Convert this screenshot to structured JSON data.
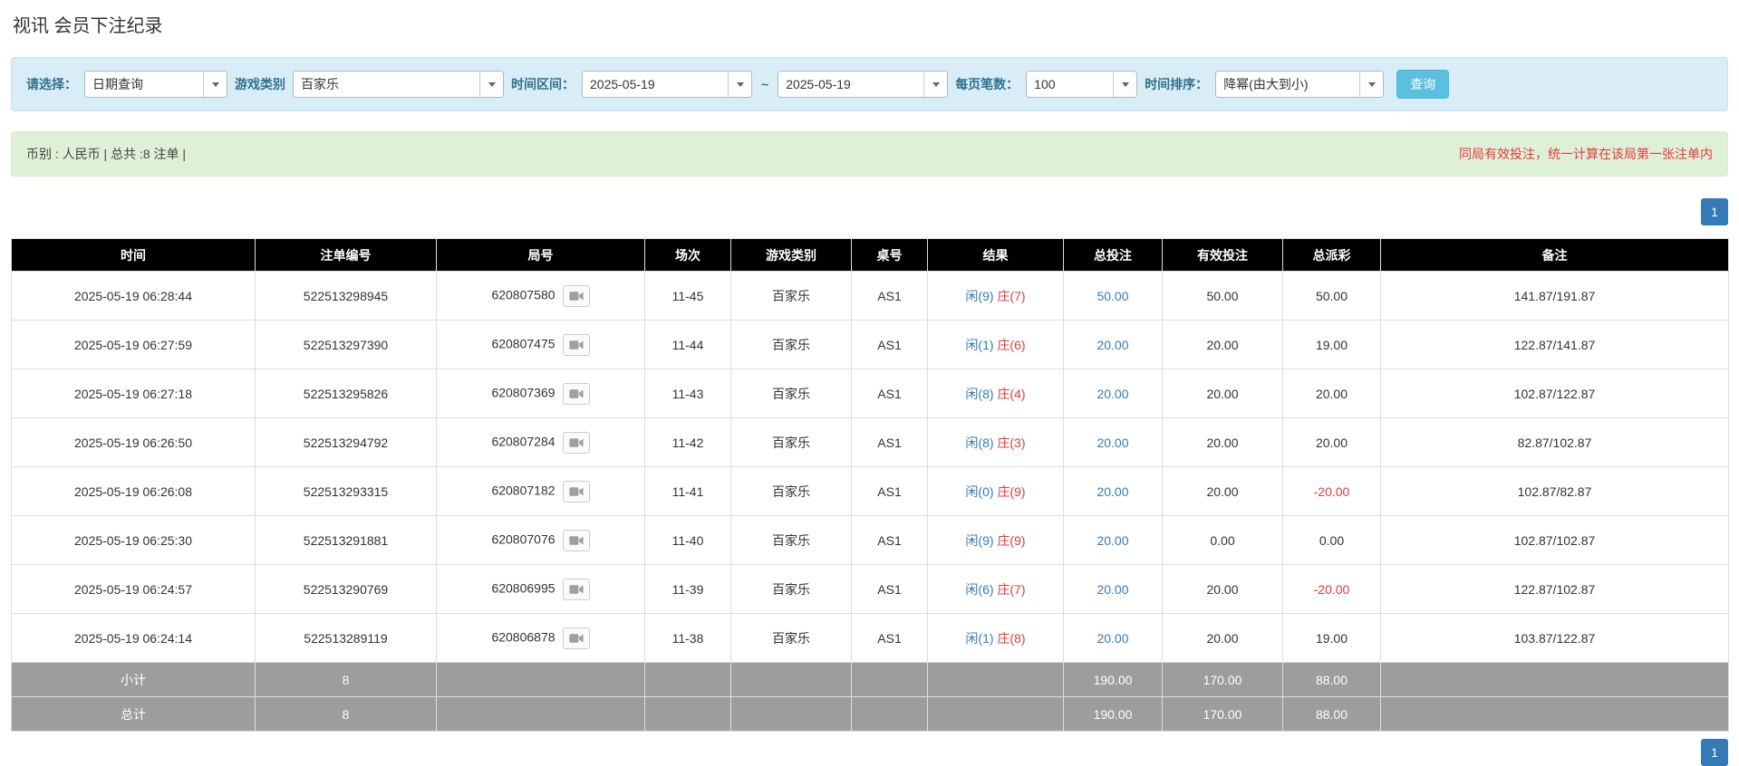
{
  "page": {
    "title": "视讯 会员下注纪录"
  },
  "colors": {
    "filter_bar_bg": "#d9edf7",
    "summary_bar_bg": "#dff0d8",
    "search_button": "#5bc0de",
    "pagination_active": "#337ab7",
    "table_header_bg": "#000000",
    "table_footer_bg": "#9d9d9d",
    "link_blue": "#337ab7",
    "alert_red": "#e4393c"
  },
  "icons": {
    "dropdown": "caret-down-icon",
    "round_video": "video-camera-icon"
  },
  "filters": {
    "select_label": "请选择：",
    "select_value": "日期查询",
    "game_type_label": "游戏类别",
    "game_type_value": "百家乐",
    "time_range_label": "时间区间：",
    "date_from": "2025-05-19",
    "range_separator": "~",
    "date_to": "2025-05-19",
    "page_size_label": "每页笔数：",
    "page_size_value": "100",
    "sort_label": "时间排序：",
    "sort_value": "降幂(由大到小)",
    "search_button_label": "查询"
  },
  "summary": {
    "left_text": "币别 : 人民币 | 总共 :8 注单 |",
    "right_note": "同局有效投注，统一计算在该局第一张注单内"
  },
  "pagination": {
    "current_page": "1"
  },
  "table": {
    "headers": [
      "时间",
      "注单编号",
      "局号",
      "场次",
      "游戏类别",
      "桌号",
      "结果",
      "总投注",
      "有效投注",
      "总派彩",
      "备注"
    ],
    "rows": [
      {
        "time": "2025-05-19 06:28:44",
        "bet_id": "522513298945",
        "round_id": "620807580",
        "session": "11-45",
        "game": "百家乐",
        "table_no": "AS1",
        "result_player": "闲(9)",
        "result_banker": "庄(7)",
        "total_bet": "50.00",
        "valid_bet": "50.00",
        "payout": "50.00",
        "payout_class": "pos",
        "remark": "141.87/191.87"
      },
      {
        "time": "2025-05-19 06:27:59",
        "bet_id": "522513297390",
        "round_id": "620807475",
        "session": "11-44",
        "game": "百家乐",
        "table_no": "AS1",
        "result_player": "闲(1)",
        "result_banker": "庄(6)",
        "total_bet": "20.00",
        "valid_bet": "20.00",
        "payout": "19.00",
        "payout_class": "pos",
        "remark": "122.87/141.87"
      },
      {
        "time": "2025-05-19 06:27:18",
        "bet_id": "522513295826",
        "round_id": "620807369",
        "session": "11-43",
        "game": "百家乐",
        "table_no": "AS1",
        "result_player": "闲(8)",
        "result_banker": "庄(4)",
        "total_bet": "20.00",
        "valid_bet": "20.00",
        "payout": "20.00",
        "payout_class": "pos",
        "remark": "102.87/122.87"
      },
      {
        "time": "2025-05-19 06:26:50",
        "bet_id": "522513294792",
        "round_id": "620807284",
        "session": "11-42",
        "game": "百家乐",
        "table_no": "AS1",
        "result_player": "闲(8)",
        "result_banker": "庄(3)",
        "total_bet": "20.00",
        "valid_bet": "20.00",
        "payout": "20.00",
        "payout_class": "pos",
        "remark": "82.87/102.87"
      },
      {
        "time": "2025-05-19 06:26:08",
        "bet_id": "522513293315",
        "round_id": "620807182",
        "session": "11-41",
        "game": "百家乐",
        "table_no": "AS1",
        "result_player": "闲(0)",
        "result_banker": "庄(9)",
        "total_bet": "20.00",
        "valid_bet": "20.00",
        "payout": "-20.00",
        "payout_class": "neg",
        "remark": "102.87/82.87"
      },
      {
        "time": "2025-05-19 06:25:30",
        "bet_id": "522513291881",
        "round_id": "620807076",
        "session": "11-40",
        "game": "百家乐",
        "table_no": "AS1",
        "result_player": "闲(9)",
        "result_banker": "庄(9)",
        "total_bet": "20.00",
        "valid_bet": "0.00",
        "payout": "0.00",
        "payout_class": "pos",
        "remark": "102.87/102.87"
      },
      {
        "time": "2025-05-19 06:24:57",
        "bet_id": "522513290769",
        "round_id": "620806995",
        "session": "11-39",
        "game": "百家乐",
        "table_no": "AS1",
        "result_player": "闲(6)",
        "result_banker": "庄(7)",
        "total_bet": "20.00",
        "valid_bet": "20.00",
        "payout": "-20.00",
        "payout_class": "neg",
        "remark": "122.87/102.87"
      },
      {
        "time": "2025-05-19 06:24:14",
        "bet_id": "522513289119",
        "round_id": "620806878",
        "session": "11-38",
        "game": "百家乐",
        "table_no": "AS1",
        "result_player": "闲(1)",
        "result_banker": "庄(8)",
        "total_bet": "20.00",
        "valid_bet": "20.00",
        "payout": "19.00",
        "payout_class": "pos",
        "remark": "103.87/122.87"
      }
    ],
    "subtotal": {
      "label": "小计",
      "count": "8",
      "total_bet": "190.00",
      "valid_bet": "170.00",
      "payout": "88.00"
    },
    "grand_total": {
      "label": "总计",
      "count": "8",
      "total_bet": "190.00",
      "valid_bet": "170.00",
      "payout": "88.00"
    }
  }
}
